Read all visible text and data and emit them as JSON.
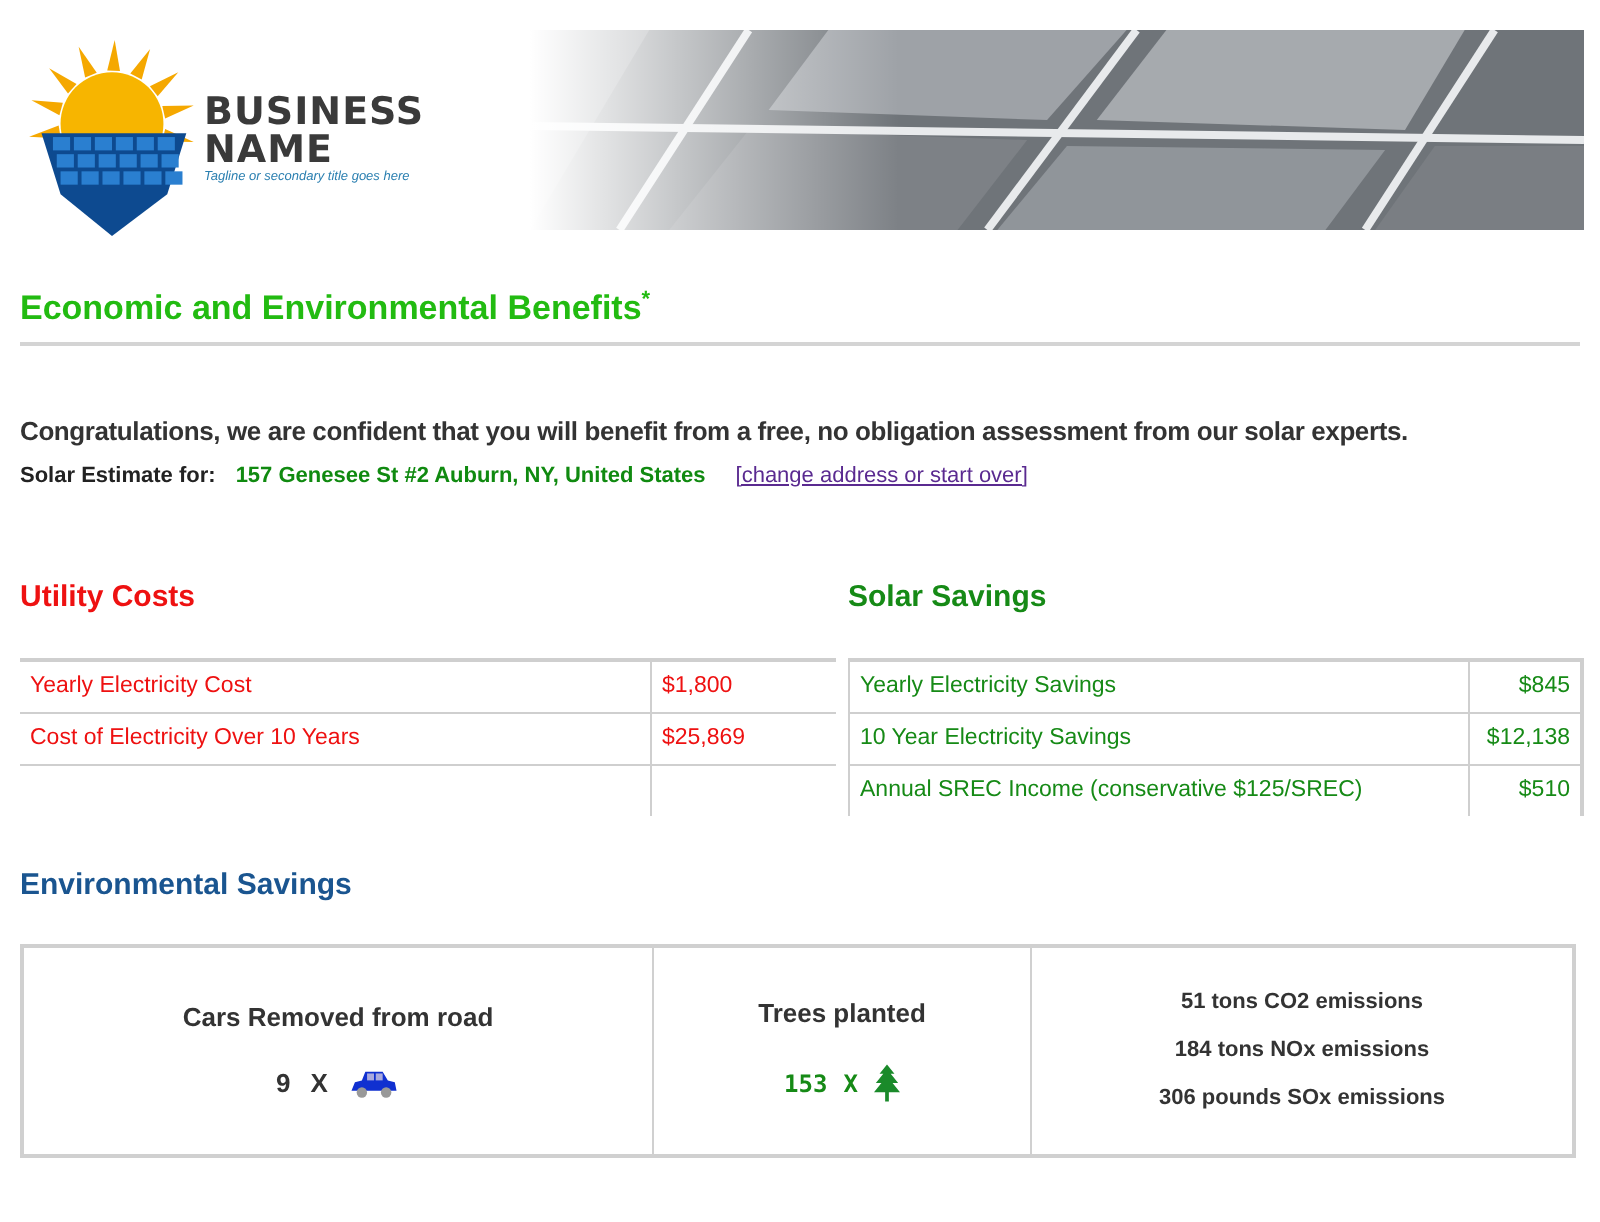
{
  "header": {
    "logo": {
      "name_lines": [
        "BUSINESS",
        "NAME"
      ],
      "tagline": "Tagline or secondary title goes here"
    }
  },
  "title": {
    "text": "Economic and Environmental Benefits",
    "mark": "*"
  },
  "intro": "Congratulations, we are confident that you will benefit from a free, no obligation assessment from our solar experts.",
  "estimate": {
    "label": "Solar Estimate for:",
    "address": "157 Genesee St #2 Auburn, NY, United States",
    "link": "[change address or start over]"
  },
  "cost_tables": [
    {
      "heading": "Utility Costs",
      "color": "#ee1111",
      "rows": [
        {
          "label": "Yearly Electricity Cost",
          "value": "$1,800"
        },
        {
          "label": "Cost of Electricity Over 10 Years",
          "value": "$25,869"
        },
        {
          "label": "",
          "value": ""
        }
      ]
    },
    {
      "heading": "Solar Savings",
      "color": "#168a16",
      "rows": [
        {
          "label": "Yearly Electricity Savings",
          "value": "$845"
        },
        {
          "label": "10 Year Electricity Savings",
          "value": "$12,138"
        },
        {
          "label": "Annual SREC Income (conservative $125/SREC)",
          "value": "$510"
        }
      ]
    }
  ],
  "environment": {
    "heading": "Environmental Savings",
    "cells": [
      {
        "kind": "cars",
        "title": "Cars Removed from road",
        "count": "9",
        "times": "X"
      },
      {
        "kind": "trees",
        "title": "Trees planted",
        "count": "153",
        "times": "X"
      },
      {
        "kind": "emissions",
        "lines": [
          "51 tons CO2 emissions",
          "184 tons NOx emissions",
          "306 pounds SOx emissions"
        ]
      }
    ]
  }
}
